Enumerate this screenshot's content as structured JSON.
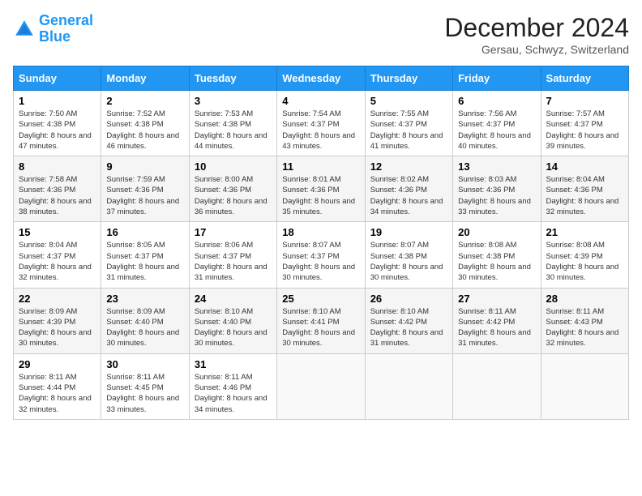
{
  "header": {
    "logo_line1": "General",
    "logo_line2": "Blue",
    "month_year": "December 2024",
    "location": "Gersau, Schwyz, Switzerland"
  },
  "weekdays": [
    "Sunday",
    "Monday",
    "Tuesday",
    "Wednesday",
    "Thursday",
    "Friday",
    "Saturday"
  ],
  "weeks": [
    [
      {
        "day": "1",
        "sunrise": "7:50 AM",
        "sunset": "4:38 PM",
        "daylight": "8 hours and 47 minutes."
      },
      {
        "day": "2",
        "sunrise": "7:52 AM",
        "sunset": "4:38 PM",
        "daylight": "8 hours and 46 minutes."
      },
      {
        "day": "3",
        "sunrise": "7:53 AM",
        "sunset": "4:38 PM",
        "daylight": "8 hours and 44 minutes."
      },
      {
        "day": "4",
        "sunrise": "7:54 AM",
        "sunset": "4:37 PM",
        "daylight": "8 hours and 43 minutes."
      },
      {
        "day": "5",
        "sunrise": "7:55 AM",
        "sunset": "4:37 PM",
        "daylight": "8 hours and 41 minutes."
      },
      {
        "day": "6",
        "sunrise": "7:56 AM",
        "sunset": "4:37 PM",
        "daylight": "8 hours and 40 minutes."
      },
      {
        "day": "7",
        "sunrise": "7:57 AM",
        "sunset": "4:37 PM",
        "daylight": "8 hours and 39 minutes."
      }
    ],
    [
      {
        "day": "8",
        "sunrise": "7:58 AM",
        "sunset": "4:36 PM",
        "daylight": "8 hours and 38 minutes."
      },
      {
        "day": "9",
        "sunrise": "7:59 AM",
        "sunset": "4:36 PM",
        "daylight": "8 hours and 37 minutes."
      },
      {
        "day": "10",
        "sunrise": "8:00 AM",
        "sunset": "4:36 PM",
        "daylight": "8 hours and 36 minutes."
      },
      {
        "day": "11",
        "sunrise": "8:01 AM",
        "sunset": "4:36 PM",
        "daylight": "8 hours and 35 minutes."
      },
      {
        "day": "12",
        "sunrise": "8:02 AM",
        "sunset": "4:36 PM",
        "daylight": "8 hours and 34 minutes."
      },
      {
        "day": "13",
        "sunrise": "8:03 AM",
        "sunset": "4:36 PM",
        "daylight": "8 hours and 33 minutes."
      },
      {
        "day": "14",
        "sunrise": "8:04 AM",
        "sunset": "4:36 PM",
        "daylight": "8 hours and 32 minutes."
      }
    ],
    [
      {
        "day": "15",
        "sunrise": "8:04 AM",
        "sunset": "4:37 PM",
        "daylight": "8 hours and 32 minutes."
      },
      {
        "day": "16",
        "sunrise": "8:05 AM",
        "sunset": "4:37 PM",
        "daylight": "8 hours and 31 minutes."
      },
      {
        "day": "17",
        "sunrise": "8:06 AM",
        "sunset": "4:37 PM",
        "daylight": "8 hours and 31 minutes."
      },
      {
        "day": "18",
        "sunrise": "8:07 AM",
        "sunset": "4:37 PM",
        "daylight": "8 hours and 30 minutes."
      },
      {
        "day": "19",
        "sunrise": "8:07 AM",
        "sunset": "4:38 PM",
        "daylight": "8 hours and 30 minutes."
      },
      {
        "day": "20",
        "sunrise": "8:08 AM",
        "sunset": "4:38 PM",
        "daylight": "8 hours and 30 minutes."
      },
      {
        "day": "21",
        "sunrise": "8:08 AM",
        "sunset": "4:39 PM",
        "daylight": "8 hours and 30 minutes."
      }
    ],
    [
      {
        "day": "22",
        "sunrise": "8:09 AM",
        "sunset": "4:39 PM",
        "daylight": "8 hours and 30 minutes."
      },
      {
        "day": "23",
        "sunrise": "8:09 AM",
        "sunset": "4:40 PM",
        "daylight": "8 hours and 30 minutes."
      },
      {
        "day": "24",
        "sunrise": "8:10 AM",
        "sunset": "4:40 PM",
        "daylight": "8 hours and 30 minutes."
      },
      {
        "day": "25",
        "sunrise": "8:10 AM",
        "sunset": "4:41 PM",
        "daylight": "8 hours and 30 minutes."
      },
      {
        "day": "26",
        "sunrise": "8:10 AM",
        "sunset": "4:42 PM",
        "daylight": "8 hours and 31 minutes."
      },
      {
        "day": "27",
        "sunrise": "8:11 AM",
        "sunset": "4:42 PM",
        "daylight": "8 hours and 31 minutes."
      },
      {
        "day": "28",
        "sunrise": "8:11 AM",
        "sunset": "4:43 PM",
        "daylight": "8 hours and 32 minutes."
      }
    ],
    [
      {
        "day": "29",
        "sunrise": "8:11 AM",
        "sunset": "4:44 PM",
        "daylight": "8 hours and 32 minutes."
      },
      {
        "day": "30",
        "sunrise": "8:11 AM",
        "sunset": "4:45 PM",
        "daylight": "8 hours and 33 minutes."
      },
      {
        "day": "31",
        "sunrise": "8:11 AM",
        "sunset": "4:46 PM",
        "daylight": "8 hours and 34 minutes."
      },
      null,
      null,
      null,
      null
    ]
  ]
}
